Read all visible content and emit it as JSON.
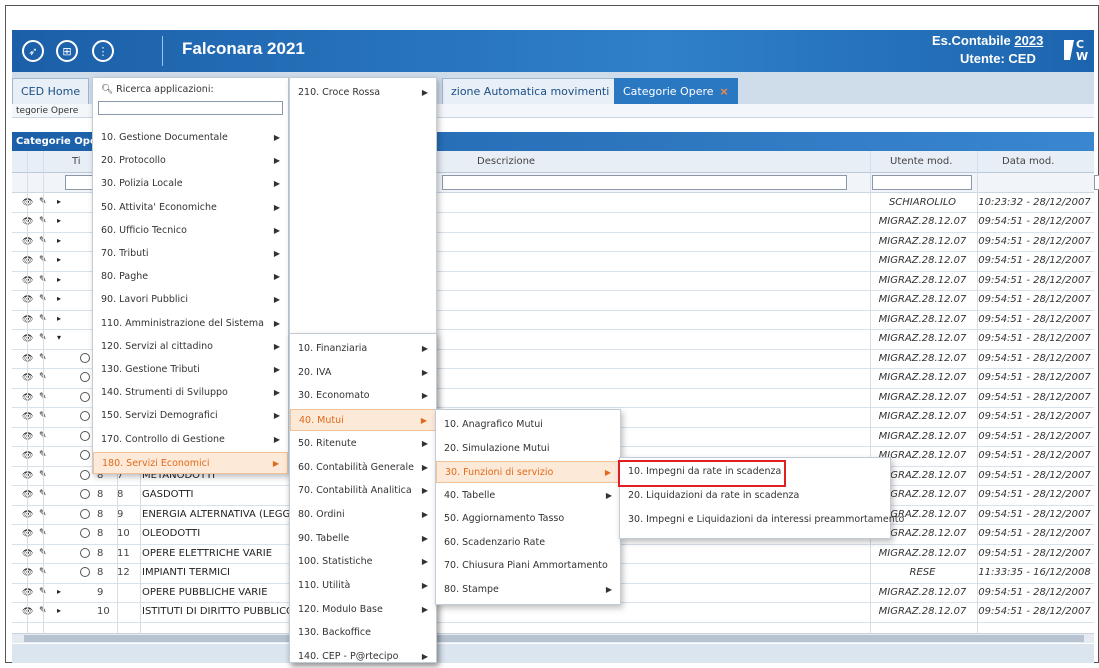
{
  "header": {
    "app_name": "Falconara 2021",
    "es_contabile_label": "Es.Contabile",
    "es_contabile_year": "2023",
    "utente": "Utente: CED",
    "logo_text": "C\nW"
  },
  "tabs": [
    {
      "label": "CED Home"
    },
    {
      "label": "zione Automatica movimenti",
      "close": "×"
    },
    {
      "label": "Categorie Opere",
      "close": "×"
    }
  ],
  "breadcrumb": "tegorie Opere",
  "grid": {
    "title": "Categorie Opere",
    "columns": {
      "tipo": "Ti",
      "descrizione": "Descrizione",
      "utente_mod": "Utente mod.",
      "data_mod": "Data mod."
    },
    "rows": [
      {
        "tipo": "",
        "cod": "",
        "desc": "",
        "user": "SCHIAROLILO",
        "date": "10:23:32 - 28/12/2007",
        "expand": "▸"
      },
      {
        "tipo": "",
        "cod": "",
        "desc": "",
        "user": "MIGRAZ.28.12.07",
        "date": "09:54:51 - 28/12/2007",
        "expand": "▸"
      },
      {
        "tipo": "",
        "cod": "",
        "desc": "",
        "user": "MIGRAZ.28.12.07",
        "date": "09:54:51 - 28/12/2007",
        "expand": "▸"
      },
      {
        "tipo": "",
        "cod": "",
        "desc": "",
        "user": "MIGRAZ.28.12.07",
        "date": "09:54:51 - 28/12/2007",
        "expand": "▸"
      },
      {
        "tipo": "",
        "cod": "",
        "desc": "",
        "user": "MIGRAZ.28.12.07",
        "date": "09:54:51 - 28/12/2007",
        "expand": "▸"
      },
      {
        "tipo": "",
        "cod": "",
        "desc": "",
        "user": "MIGRAZ.28.12.07",
        "date": "09:54:51 - 28/12/2007",
        "expand": "▸"
      },
      {
        "tipo": "",
        "cod": "",
        "desc": "",
        "user": "MIGRAZ.28.12.07",
        "date": "09:54:51 - 28/12/2007",
        "expand": "▸"
      },
      {
        "tipo": "",
        "cod": "",
        "desc": "",
        "user": "MIGRAZ.28.12.07",
        "date": "09:54:51 - 28/12/2007",
        "expand": "▾"
      },
      {
        "tipo": "",
        "cod": "",
        "desc": "",
        "user": "MIGRAZ.28.12.07",
        "date": "09:54:51 - 28/12/2007",
        "radio": true
      },
      {
        "tipo": "",
        "cod": "",
        "desc": "",
        "user": "MIGRAZ.28.12.07",
        "date": "09:54:51 - 28/12/2007",
        "radio": true
      },
      {
        "tipo": "",
        "cod": "",
        "desc": "",
        "user": "MIGRAZ.28.12.07",
        "date": "09:54:51 - 28/12/2007",
        "radio": true
      },
      {
        "tipo": "",
        "cod": "",
        "desc": "",
        "user": "MIGRAZ.28.12.07",
        "date": "09:54:51 - 28/12/2007",
        "radio": true
      },
      {
        "tipo": "",
        "cod": "",
        "desc": "",
        "user": "MIGRAZ.28.12.07",
        "date": "09:54:51 - 28/12/2007",
        "radio": true
      },
      {
        "tipo": "",
        "cod": "",
        "desc": "",
        "user": "MIGRAZ.28.12.07",
        "date": "09:54:51 - 28/12/2007",
        "radio": true
      },
      {
        "tipo": "8",
        "cod": "7",
        "desc": "METANODOTTI",
        "user": "MIGRAZ.28.12.07",
        "date": "09:54:51 - 28/12/2007",
        "radio": true
      },
      {
        "tipo": "8",
        "cod": "8",
        "desc": "GASDOTTI",
        "user": "MIGRAZ.28.12.07",
        "date": "09:54:51 - 28/12/2007",
        "radio": true
      },
      {
        "tipo": "8",
        "cod": "9",
        "desc": "ENERGIA ALTERNATIVA (LEGGE",
        "user": "MIGRAZ.28.12.07",
        "date": "09:54:51 - 28/12/2007",
        "radio": true
      },
      {
        "tipo": "8",
        "cod": "10",
        "desc": "OLEODOTTI",
        "user": "MIGRAZ.28.12.07",
        "date": "09:54:51 - 28/12/2007",
        "radio": true
      },
      {
        "tipo": "8",
        "cod": "11",
        "desc": "OPERE ELETTRICHE VARIE",
        "user": "MIGRAZ.28.12.07",
        "date": "09:54:51 - 28/12/2007",
        "radio": true
      },
      {
        "tipo": "8",
        "cod": "12",
        "desc": "IMPIANTI TERMICI",
        "user": "RESE",
        "date": "11:33:35 - 16/12/2008",
        "radio": true
      },
      {
        "tipo": "9",
        "cod": "",
        "desc": "OPERE PUBBLICHE VARIE",
        "user": "MIGRAZ.28.12.07",
        "date": "09:54:51 - 28/12/2007",
        "expand": "▸"
      },
      {
        "tipo": "10",
        "cod": "",
        "desc": "ISTITUTI DI DIRITTO PUBBLICO",
        "user": "MIGRAZ.28.12.07",
        "date": "09:54:51 - 28/12/2007",
        "expand": "▸"
      }
    ]
  },
  "menu1": {
    "search_label": "Ricerca applicazioni:",
    "items": [
      "10. Gestione Documentale",
      "20. Protocollo",
      "30. Polizia Locale",
      "50. Attivita' Economiche",
      "60. Ufficio Tecnico",
      "70. Tributi",
      "80. Paghe",
      "90. Lavori Pubblici",
      "110. Amministrazione del Sistema",
      "120. Servizi al cittadino",
      "130. Gestione Tributi",
      "140. Strumenti di Sviluppo",
      "150. Servizi Demografici",
      "170. Controllo di Gestione",
      "180. Servizi Economici"
    ]
  },
  "menu2": {
    "items": [
      "210. Croce Rossa"
    ]
  },
  "menu3": {
    "items": [
      "10. Finanziaria",
      "20. IVA",
      "30. Economato",
      "40. Mutui",
      "50. Ritenute",
      "60. Contabilità Generale",
      "70. Contabilità Analitica",
      "80. Ordini",
      "90. Tabelle",
      "100. Statistiche",
      "110. Utilità",
      "120. Modulo Base",
      "130. Backoffice",
      "140. CEP - P@rtecipo"
    ]
  },
  "menu4": {
    "items": [
      "10. Anagrafico Mutui",
      "20. Simulazione Mutui",
      "30. Funzioni di servizio",
      "40. Tabelle",
      "50. Aggiornamento Tasso",
      "60. Scadenzario Rate",
      "70. Chiusura Piani Ammortamento",
      "80. Stampe"
    ]
  },
  "menu5": {
    "items": [
      "10. Impegni da rate in scadenza",
      "20. Liquidazioni da rate in scadenza",
      "30. Impegni e Liquidazioni da interessi preammortamento"
    ]
  }
}
